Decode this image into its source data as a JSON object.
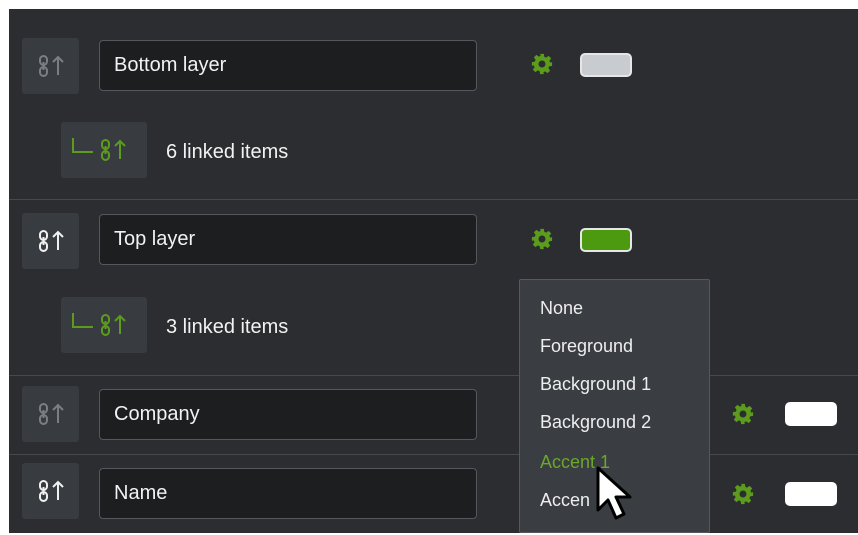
{
  "colors": {
    "panel_bg": "#2b2d30",
    "accent_green": "#5c9c1c",
    "swatch_grey": "#c8ccd0",
    "swatch_green": "#4c9a10",
    "swatch_white": "#ffffff"
  },
  "layers": [
    {
      "name": "Bottom layer",
      "link_icon": "link-up-icon",
      "link_state": "dim",
      "swatch_color": "#c8ccd0",
      "linked_items_label": "6 linked items"
    },
    {
      "name": "Top layer",
      "link_icon": "link-up-icon",
      "link_state": "bright",
      "swatch_color": "#4c9a10",
      "linked_items_label": "3 linked items"
    },
    {
      "name": "Company",
      "link_icon": "link-up-icon",
      "link_state": "dim",
      "swatch_color": "#ffffff"
    },
    {
      "name": "Name",
      "link_icon": "link-up-icon",
      "link_state": "bright",
      "swatch_color": "#ffffff"
    }
  ],
  "dropdown": {
    "options": [
      "None",
      "Foreground",
      "Background 1",
      "Background 2",
      "Accent 1",
      "Accen"
    ],
    "highlighted": "Accent 1"
  }
}
